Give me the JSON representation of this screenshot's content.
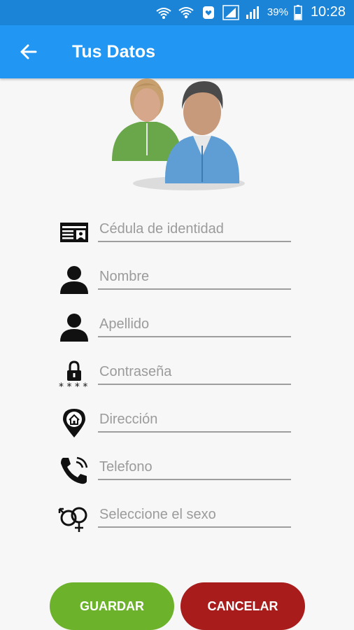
{
  "status_bar": {
    "battery_percent": "39%",
    "time": "10:28",
    "icons": [
      "wifi-calling-icon",
      "wifi-icon",
      "notification-icon",
      "signal-sim1-icon",
      "signal-sim2-icon",
      "battery-icon"
    ]
  },
  "app_bar": {
    "title": "Tus Datos",
    "back_icon": "arrow-left-icon",
    "color": "#2196f3"
  },
  "header_image": "people-avatar-icon",
  "form": {
    "fields": [
      {
        "icon": "id-card-icon",
        "value": "",
        "placeholder": "Cédula de identidad"
      },
      {
        "icon": "person-icon",
        "value": "",
        "placeholder": "Nombre"
      },
      {
        "icon": "person-icon",
        "value": "",
        "placeholder": "Apellido"
      },
      {
        "icon": "lock-password-icon",
        "value": "",
        "placeholder": "Contraseña"
      },
      {
        "icon": "location-home-icon",
        "value": "",
        "placeholder": "Dirección"
      },
      {
        "icon": "phone-icon",
        "value": "",
        "placeholder": "Telefono"
      },
      {
        "icon": "gender-icon",
        "value": "",
        "placeholder": "Seleccione el sexo"
      }
    ]
  },
  "buttons": {
    "save_label": "GUARDAR",
    "save_color": "#6cb22a",
    "cancel_label": "CANCELAR",
    "cancel_color": "#a81c1c"
  }
}
